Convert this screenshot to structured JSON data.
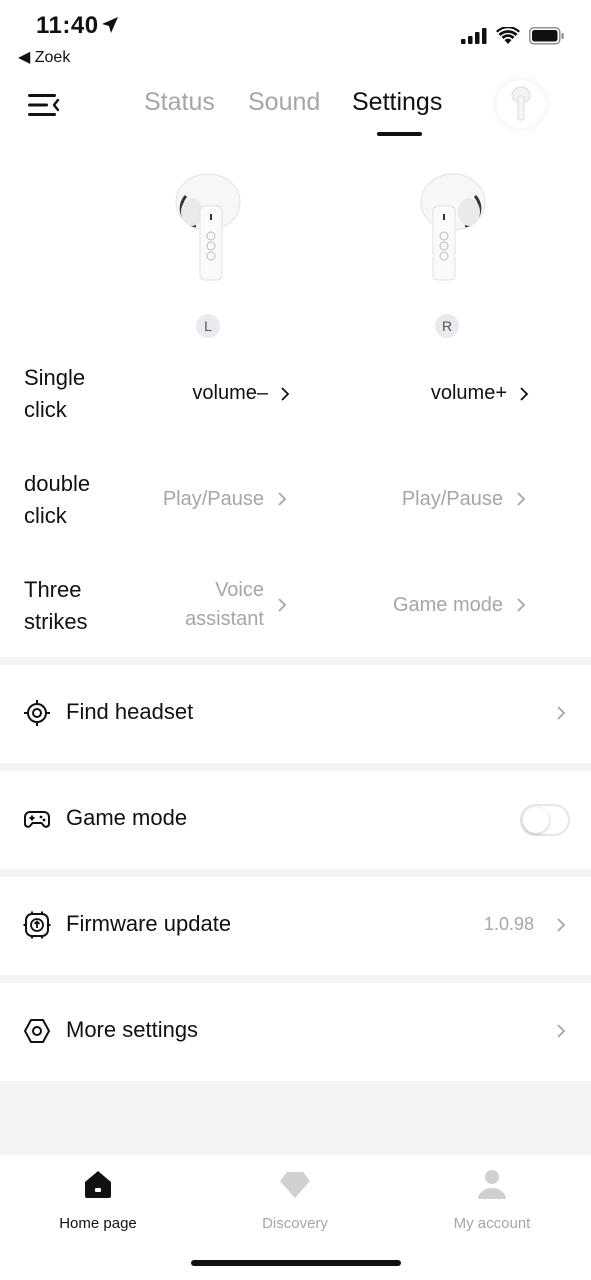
{
  "status_bar": {
    "time": "11:40",
    "back_app_label": "◀ Zoek"
  },
  "nav": {
    "tabs": [
      {
        "label": "Status",
        "active": false
      },
      {
        "label": "Sound",
        "active": false
      },
      {
        "label": "Settings",
        "active": true
      }
    ]
  },
  "earbuds": {
    "left_label": "L",
    "right_label": "R"
  },
  "gestures": [
    {
      "label": "Single click",
      "left": "volume–",
      "right": "volume+",
      "style": "dark"
    },
    {
      "label": "double click",
      "left": "Play/Pause",
      "right": "Play/Pause",
      "style": "grey"
    },
    {
      "label": "Three strikes",
      "left": "Voice assistant",
      "right": "Game mode",
      "style": "grey"
    }
  ],
  "list": {
    "find_headset": {
      "label": "Find headset",
      "icon": "crosshair-icon"
    },
    "game_mode": {
      "label": "Game mode",
      "icon": "gamepad-icon",
      "toggle_on": false
    },
    "firmware_update": {
      "label": "Firmware update",
      "icon": "chip-upload-icon",
      "version": "1.0.98"
    },
    "more_settings": {
      "label": "More settings",
      "icon": "hexagon-settings-icon"
    }
  },
  "bottom_tabs": [
    {
      "label": "Home page",
      "icon": "home-icon",
      "active": true
    },
    {
      "label": "Discovery",
      "icon": "diamond-icon",
      "active": false
    },
    {
      "label": "My account",
      "icon": "person-icon",
      "active": false
    }
  ],
  "colors": {
    "accent": "#111111",
    "muted": "#a6a6a6",
    "divider": "#f3f3f5"
  }
}
